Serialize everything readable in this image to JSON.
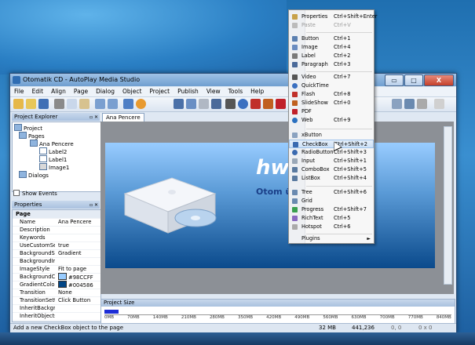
{
  "window": {
    "title": "Otomatik CD - AutoPlay Media Studio",
    "buttons": {
      "minimize": "▭",
      "maximize": "□",
      "close": "X"
    }
  },
  "menubar": [
    "File",
    "Edit",
    "Align",
    "Page",
    "Dialog",
    "Object",
    "Project",
    "Publish",
    "View",
    "Tools",
    "Help"
  ],
  "explorer": {
    "title": "Project Explorer",
    "tree": [
      "Project",
      "Pages",
      "Ana Pencere",
      "Label2",
      "Label1",
      "Image1",
      "Dialogs"
    ],
    "show_events": "Show Events"
  },
  "properties": {
    "title": "Properties",
    "section": "Page",
    "rows": [
      {
        "name": "Name",
        "value": "Ana Pencere"
      },
      {
        "name": "Description",
        "value": ""
      },
      {
        "name": "Keywords",
        "value": ""
      },
      {
        "name": "UseCustomSett",
        "value": "true"
      },
      {
        "name": "BackgroundStyl",
        "value": "Gradient"
      },
      {
        "name": "BackgroundIma",
        "value": ""
      },
      {
        "name": "ImageStyle",
        "value": "Fit to page"
      },
      {
        "name": "BackgroundCol",
        "value": "#98CCFF"
      },
      {
        "name": "GradientColor",
        "value": "#004586"
      },
      {
        "name": "Transition",
        "value": "None"
      },
      {
        "name": "TransitionSettin",
        "value": "Click Button"
      },
      {
        "name": "InheritBackgrou",
        "value": ""
      },
      {
        "name": "InheritObjectsF",
        "value": ""
      }
    ],
    "colors": {
      "bg": "#98CCFF",
      "gradient": "#004586"
    }
  },
  "document": {
    "tab": "Ana Pencere",
    "brand_text": "hw      om",
    "tagline": "Otom                 ükleyici"
  },
  "project_size": {
    "title": "Project Size",
    "ruler": [
      "0MB",
      "70MB",
      "140MB",
      "210MB",
      "280MB",
      "350MB",
      "420MB",
      "490MB",
      "560MB",
      "630MB",
      "700MB",
      "770MB",
      "840MB"
    ]
  },
  "status": {
    "message": "Add a new CheckBox object to the page",
    "size": "32 MB",
    "coords": "441,236",
    "pos": "0, 0",
    "dim": "0 x 0"
  },
  "menu": {
    "items": [
      {
        "label": "Properties",
        "shortcut": "Ctrl+Shift+Enter",
        "icon": "properties-icon",
        "color": "#c8a24a"
      },
      {
        "label": "Paste",
        "shortcut": "Ctrl+V",
        "icon": "paste-icon",
        "disabled": true,
        "color": "#bbbbbb"
      },
      {
        "label": "Button",
        "shortcut": "Ctrl+1",
        "icon": "button-icon",
        "color": "#5a7fb0"
      },
      {
        "label": "Image",
        "shortcut": "Ctrl+4",
        "icon": "image-icon",
        "color": "#6a8cc0"
      },
      {
        "label": "Label",
        "shortcut": "Ctrl+2",
        "icon": "label-icon",
        "color": "#7a7a7a"
      },
      {
        "label": "Paragraph",
        "shortcut": "Ctrl+3",
        "icon": "paragraph-icon",
        "color": "#4a6a9a"
      },
      {
        "label": "Video",
        "shortcut": "Ctrl+7",
        "icon": "video-icon",
        "color": "#555555"
      },
      {
        "label": "QuickTime",
        "shortcut": "",
        "icon": "quicktime-icon",
        "color": "#3a6fc0"
      },
      {
        "label": "Flash",
        "shortcut": "Ctrl+8",
        "icon": "flash-icon",
        "color": "#c0302a"
      },
      {
        "label": "SlideShow",
        "shortcut": "Ctrl+0",
        "icon": "slideshow-icon",
        "color": "#c06020"
      },
      {
        "label": "PDF",
        "shortcut": "",
        "icon": "pdf-icon",
        "color": "#c0202a"
      },
      {
        "label": "Web",
        "shortcut": "Ctrl+9",
        "icon": "web-icon",
        "color": "#2a70c0"
      },
      {
        "label": "xButton",
        "shortcut": "",
        "icon": "xbutton-icon",
        "color": "#8aa2c0"
      },
      {
        "label": "CheckBox",
        "shortcut": "Ctrl+Shift+2",
        "icon": "checkbox-icon",
        "color": "#3a6ab0"
      },
      {
        "label": "RadioButton",
        "shortcut": "Ctrl+Shift+3",
        "icon": "radiobutton-icon",
        "color": "#3a6ab0"
      },
      {
        "label": "Input",
        "shortcut": "Ctrl+Shift+1",
        "icon": "input-icon",
        "color": "#9aa8b8"
      },
      {
        "label": "ComboBox",
        "shortcut": "Ctrl+Shift+5",
        "icon": "combobox-icon",
        "color": "#5a7aa0"
      },
      {
        "label": "ListBox",
        "shortcut": "Ctrl+Shift+4",
        "icon": "listbox-icon",
        "color": "#5a7aa0"
      },
      {
        "label": "Tree",
        "shortcut": "Ctrl+Shift+6",
        "icon": "tree-icon",
        "color": "#6a8ab0"
      },
      {
        "label": "Grid",
        "shortcut": "",
        "icon": "grid-icon",
        "color": "#6a8ab0"
      },
      {
        "label": "Progress",
        "shortcut": "Ctrl+Shift+7",
        "icon": "progress-icon",
        "color": "#3aa050"
      },
      {
        "label": "RichText",
        "shortcut": "Ctrl+5",
        "icon": "richtext-icon",
        "color": "#8a6ac0"
      },
      {
        "label": "Hotspot",
        "shortcut": "Ctrl+6",
        "icon": "hotspot-icon",
        "color": "#aaaaaa"
      },
      {
        "label": "Plugins",
        "shortcut": "",
        "icon": "",
        "color": "#f7f7f7",
        "submenu": true
      }
    ],
    "submenu_arrow": "►"
  }
}
